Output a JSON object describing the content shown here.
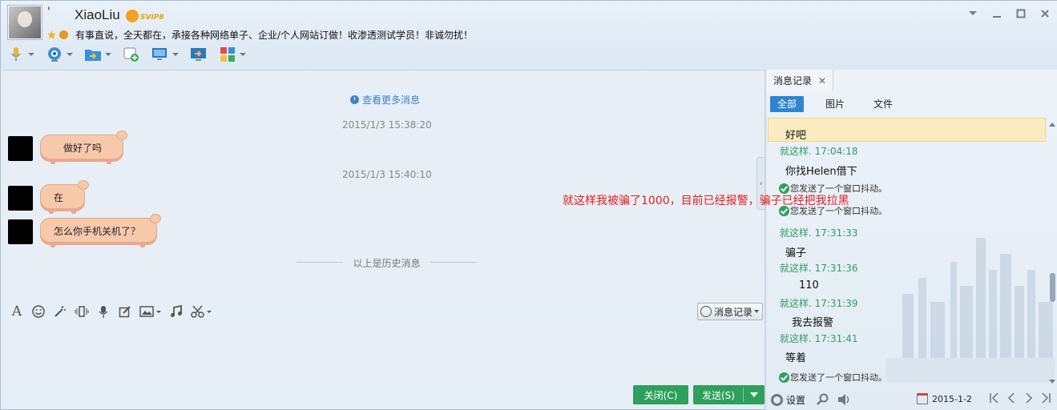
{
  "header": {
    "tick": "'",
    "contact_name": "XiaoLiu",
    "vip_label": "SVIP8",
    "signature": "有事直说，全天都在，承接各种网络单子、企业/个人网站订做！收渗透测试学员！非诚勿扰！"
  },
  "toolbar": {
    "icons": [
      "microphone-icon",
      "webcam-icon",
      "file-transfer-icon",
      "create-group-icon",
      "remote-desktop-icon",
      "screen-share-icon",
      "apps-icon"
    ]
  },
  "chat": {
    "view_more": "查看更多消息",
    "messages": [
      {
        "timestamp": "2015/1/3 15:38:20",
        "text": "做好了吗"
      },
      {
        "timestamp": "2015/1/3 15:40:10",
        "text": "在"
      },
      {
        "timestamp": "",
        "text": "怎么你手机关机了？"
      }
    ],
    "history_divider": "以上是历史消息"
  },
  "input_toolbar": {
    "history_button": "消息记录"
  },
  "send_bar": {
    "close_label": "关闭(C)",
    "send_label": "发送(S)"
  },
  "history_panel": {
    "tab_title": "消息记录",
    "filters": [
      "全部",
      "图片",
      "文件"
    ],
    "records": [
      {
        "kind": "msg",
        "text": "好吧"
      },
      {
        "kind": "stamp",
        "text": "就这样. 17:04:18"
      },
      {
        "kind": "msg",
        "text": "你找Helen借下"
      },
      {
        "kind": "shake",
        "text": "您发送了一个窗口抖动。"
      },
      {
        "kind": "shake",
        "text": "您发送了一个窗口抖动。"
      },
      {
        "kind": "stamp",
        "text": "就这样. 17:31:33"
      },
      {
        "kind": "msg",
        "text": "骗子"
      },
      {
        "kind": "stamp",
        "text": "就这样. 17:31:36"
      },
      {
        "kind": "msg",
        "text": "110"
      },
      {
        "kind": "stamp",
        "text": "就这样. 17:31:39"
      },
      {
        "kind": "msg",
        "text": "我去报警"
      },
      {
        "kind": "stamp",
        "text": "就这样. 17:31:41"
      },
      {
        "kind": "msg",
        "text": "等着"
      },
      {
        "kind": "shake",
        "text": "您发送了一个窗口抖动。"
      }
    ],
    "footer": {
      "settings_label": "设置",
      "date": "2015-1-2"
    }
  },
  "overlay_note": "就这样我被骗了1000，目前已经报警，骗子已经把我拉黑",
  "colors": {
    "accent": "#2f84d2",
    "send_button": "#2f9f5c",
    "bubble": "#f7c9ab",
    "overlay_text": "#e21f1f"
  }
}
